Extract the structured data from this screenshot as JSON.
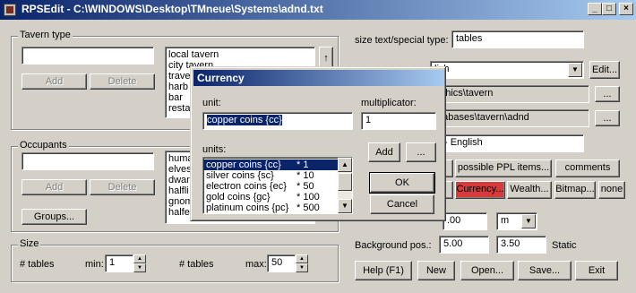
{
  "window": {
    "title": "RPSEdit - C:\\WINDOWS\\Desktop\\TMneue\\Systems\\adnd.txt",
    "min": "_",
    "max": "□",
    "close": "×"
  },
  "tavern": {
    "group_label": "Tavern type",
    "input_value": "",
    "add": "Add",
    "delete": "Delete",
    "items": [
      "local tavern",
      "city tavern",
      "trave",
      "harb",
      "bar",
      "resta"
    ]
  },
  "occupants": {
    "group_label": "Occupants",
    "input_value": "",
    "add": "Add",
    "delete": "Delete",
    "groups": "Groups...",
    "items": [
      "huma",
      "elves",
      "dwar",
      "halfli",
      "gnom",
      "halfe"
    ]
  },
  "size": {
    "group_label": "Size",
    "unit1": "# tables",
    "min_label": "min:",
    "min_value": "1",
    "unit2": "# tables",
    "max_label": "max:",
    "max_value": "50"
  },
  "right": {
    "size_text_label": "size text/special type:",
    "size_text_value": "tables",
    "language_value": "lish",
    "edit_button": "Edit...",
    "path1": "aphics\\tavern",
    "path2": "atabases\\tavern\\adnd",
    "browse": "...",
    "lang_name": "D - English",
    "possible_ppl": "possible PPL items...",
    "comments": "comments",
    "currency": "Currency...",
    "wealth": "Wealth...",
    "bitmap": "Bitmap...",
    "none": "none",
    "scale_value": ".00",
    "scale_unit": "m",
    "bg_pos_label": "Background pos.:",
    "bg_x": "5.00",
    "bg_y": "3.50",
    "static_label": "Static"
  },
  "bottom": {
    "help": "Help (F1)",
    "new": "New",
    "open": "Open...",
    "save": "Save...",
    "exit": "Exit"
  },
  "dialog": {
    "title": "Currency",
    "unit_label": "unit:",
    "unit_value": "copper coins {cc}",
    "multiplicator_label": "multiplicator:",
    "multiplicator_value": "1",
    "units_label": "units:",
    "units": [
      {
        "name": "copper coins {cc}",
        "mul": "* 1"
      },
      {
        "name": "silver coins {sc}",
        "mul": "* 10"
      },
      {
        "name": "electron coins {ec}",
        "mul": "* 50"
      },
      {
        "name": "gold coins {gc}",
        "mul": "* 100"
      },
      {
        "name": "platinum coins {pc}",
        "mul": "* 500"
      }
    ],
    "add": "Add",
    "more": "...",
    "ok": "OK",
    "cancel": "Cancel"
  },
  "colors": {
    "title_start": "#0a246a",
    "title_end": "#a6caf0",
    "currency_button": "#d63a3a"
  }
}
